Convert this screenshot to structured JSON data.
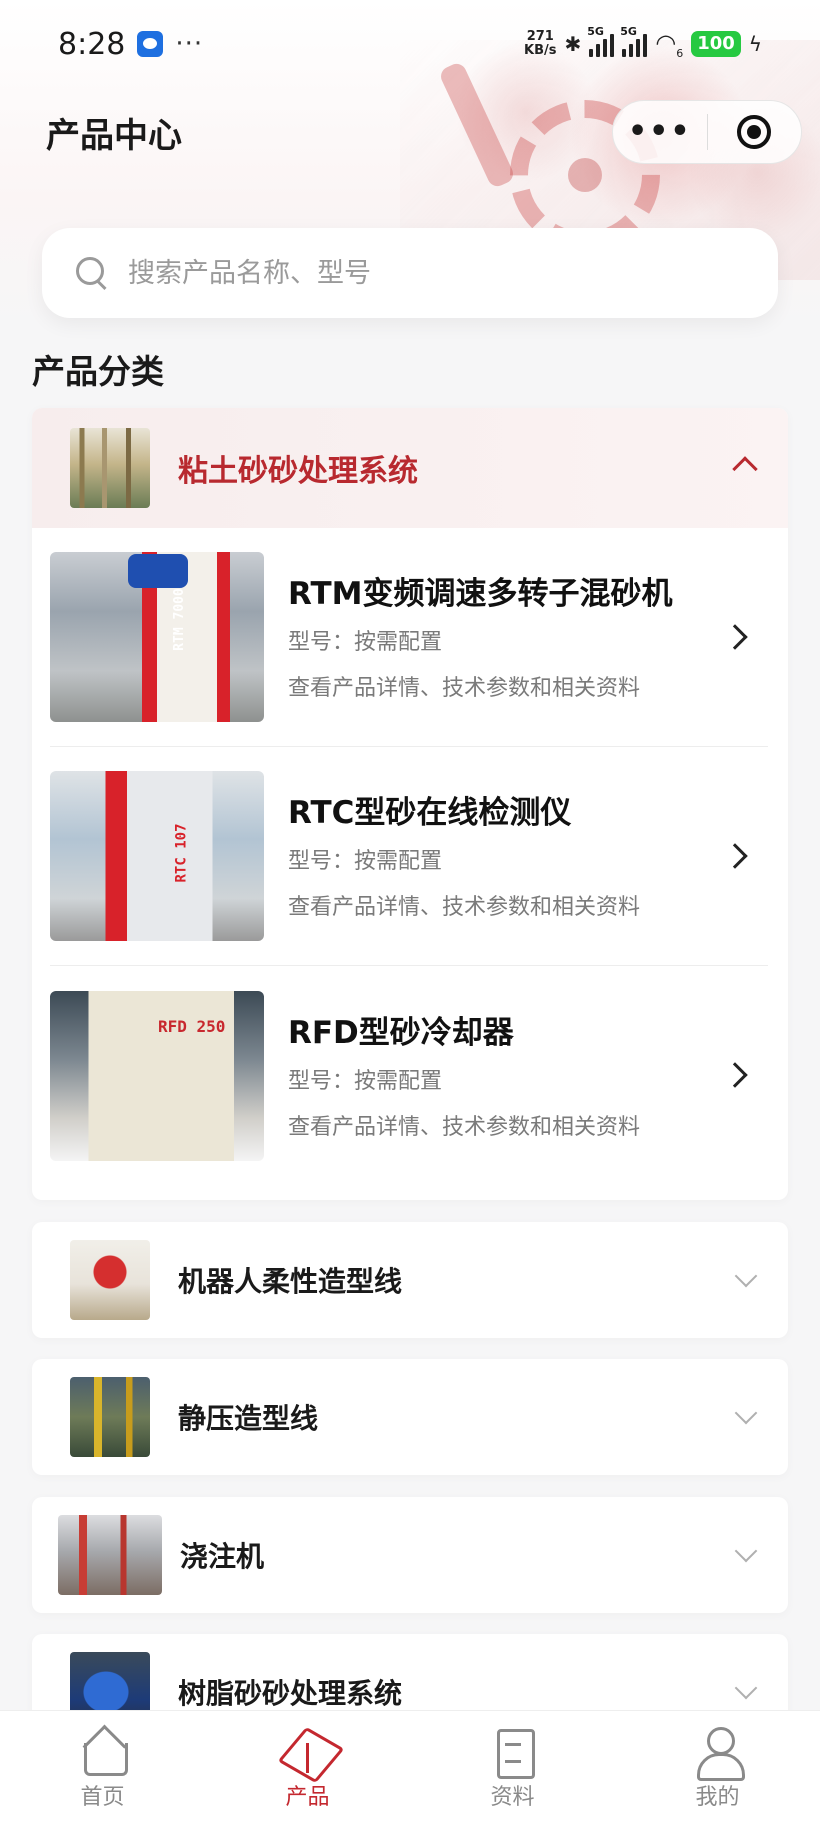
{
  "status_bar": {
    "time": "8:28",
    "more": "···",
    "net_speed_value": "271",
    "net_speed_unit": "KB/s",
    "signal_1_label": "5G",
    "signal_2_label": "5G",
    "wifi_suffix": "6",
    "battery": "100"
  },
  "header": {
    "title": "产品中心",
    "capsule_more": "•••"
  },
  "search": {
    "placeholder": "搜索产品名称、型号"
  },
  "section": {
    "title": "产品分类"
  },
  "categories": [
    {
      "name": "粘土砂砂处理系统",
      "expanded": true,
      "products": [
        {
          "name": "RTM变频调速多转子混砂机",
          "model": "型号：按需配置",
          "desc": "查看产品详情、技术参数和相关资料",
          "image_label": "RTM 7000"
        },
        {
          "name": "RTC型砂在线检测仪",
          "model": "型号：按需配置",
          "desc": "查看产品详情、技术参数和相关资料",
          "image_label": "RTC 107"
        },
        {
          "name": "RFD型砂冷却器",
          "model": "型号：按需配置",
          "desc": "查看产品详情、技术参数和相关资料",
          "image_label": "RFD 250"
        }
      ]
    },
    {
      "name": "机器人柔性造型线",
      "expanded": false
    },
    {
      "name": "静压造型线",
      "expanded": false
    },
    {
      "name": "浇注机",
      "expanded": false
    },
    {
      "name": "树脂砂砂处理系统",
      "expanded": false
    }
  ],
  "tabbar": {
    "tabs": [
      {
        "label": "首页",
        "icon": "home-icon",
        "active": false
      },
      {
        "label": "产品",
        "icon": "box-icon",
        "active": true
      },
      {
        "label": "资料",
        "icon": "document-icon",
        "active": false
      },
      {
        "label": "我的",
        "icon": "user-icon",
        "active": false
      }
    ]
  },
  "colors": {
    "accent": "#c4282f",
    "battery": "#26c941",
    "background": "#f6f6f7"
  }
}
